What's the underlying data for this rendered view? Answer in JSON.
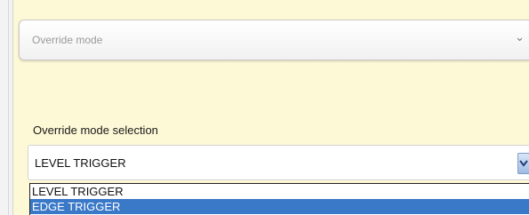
{
  "section": {
    "title": "Override mode",
    "chevron_icon": "chevron-down-icon"
  },
  "field": {
    "label": "Override mode selection",
    "selected_value": "LEVEL TRIGGER",
    "arrow_icon": "dropdown-arrow-icon"
  },
  "dropdown": {
    "options": [
      {
        "label": "LEVEL TRIGGER",
        "highlighted": false
      },
      {
        "label": "EDGE TRIGGER",
        "highlighted": true
      }
    ]
  },
  "colors": {
    "panel_background": "#fdf8d6",
    "highlight": "#3a78c8"
  }
}
